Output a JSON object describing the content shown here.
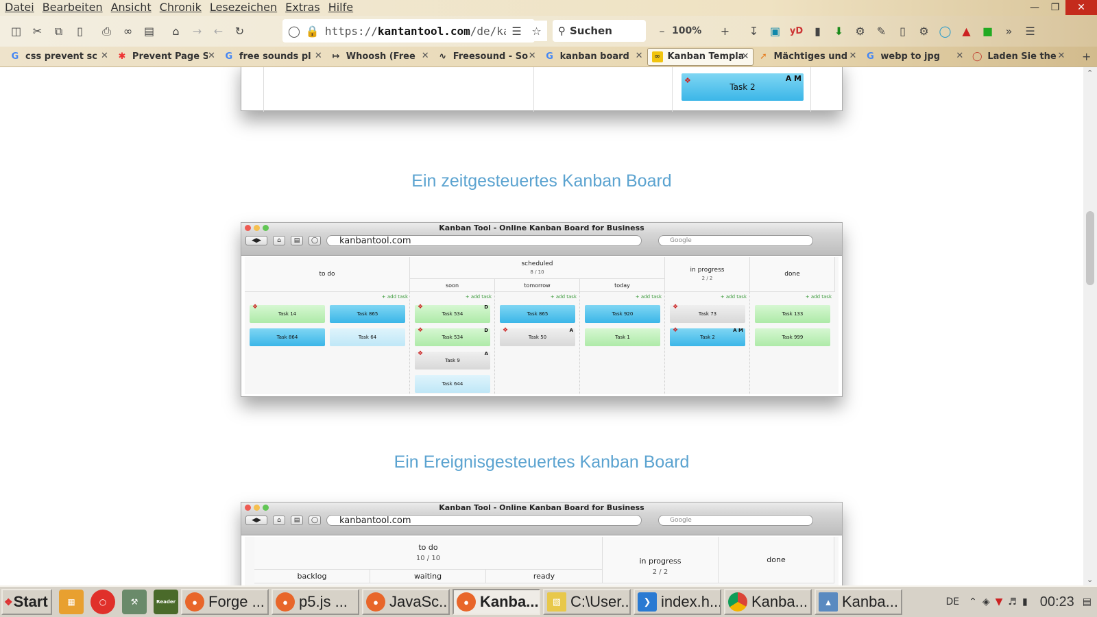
{
  "menubar": {
    "items": [
      "Datei",
      "Bearbeiten",
      "Ansicht",
      "Chronik",
      "Lesezeichen",
      "Extras",
      "Hilfe"
    ]
  },
  "navbar": {
    "url_prefix": "https://",
    "url_domain": "kantantool.com",
    "url_path": "/de/kan",
    "search_label": "Suchen",
    "zoom": "100%"
  },
  "tabs": [
    {
      "title": "css prevent sc",
      "icon": "google-icon"
    },
    {
      "title": "Prevent Page S",
      "icon": "asterisk-icon"
    },
    {
      "title": "free sounds pl",
      "icon": "google-icon"
    },
    {
      "title": "Whoosh (Free",
      "icon": "whoosh-icon"
    },
    {
      "title": "Freesound - So",
      "icon": "waveform-icon"
    },
    {
      "title": "kanban board",
      "icon": "google-icon"
    },
    {
      "title": "Kanban Templa",
      "icon": "kanban-icon",
      "active": true
    },
    {
      "title": "Mächtiges und",
      "icon": "chart-icon"
    },
    {
      "title": "webp to jpg",
      "icon": "google-icon"
    },
    {
      "title": "Laden Sie the",
      "icon": "opera-icon"
    }
  ],
  "content": {
    "heading1": "Ein zeitgesteuertes Kanban Board",
    "heading2": "Ein Ereignisgesteuertes Kanban Board",
    "top_card": {
      "label": "Task 2",
      "initials": "A M"
    },
    "mac": {
      "title": "Kanban Tool - Online Kanban Board for Business",
      "url": "kanbantool.com",
      "search_placeholder": "Google"
    },
    "board1": {
      "add_task": "+ add task",
      "col_todo": "to do",
      "col_scheduled": "scheduled",
      "scheduled_count": "8 / 10",
      "sub_soon": "soon",
      "sub_tomorrow": "tomorrow",
      "sub_today": "today",
      "col_inprogress": "in progress",
      "inprogress_count": "2 / 2",
      "col_done": "done",
      "cards": [
        {
          "label": "Task 14"
        },
        {
          "label": "Task 865"
        },
        {
          "label": "Task 864"
        },
        {
          "label": "Task 64"
        },
        {
          "label": "Task 534",
          "initials": "D"
        },
        {
          "label": "Task 534",
          "initials": "D"
        },
        {
          "label": "Task 9",
          "initials": "A"
        },
        {
          "label": "Task 644"
        },
        {
          "label": "Task 865"
        },
        {
          "label": "Task 50",
          "initials": "A"
        },
        {
          "label": "Task 920"
        },
        {
          "label": "Task 1"
        },
        {
          "label": "Task 73"
        },
        {
          "label": "Task 2",
          "initials": "A M"
        },
        {
          "label": "Task 133"
        },
        {
          "label": "Task 999"
        }
      ]
    },
    "board2": {
      "col_todo": "to do",
      "todo_count": "10 / 10",
      "sub_backlog": "backlog",
      "sub_waiting": "waiting",
      "sub_ready": "ready",
      "col_inprogress": "in progress",
      "inprogress_count": "2 / 2",
      "col_done": "done"
    }
  },
  "taskbar": {
    "start": "Start",
    "tasks": [
      {
        "label": "Forge ...",
        "icon": "firefox-icon"
      },
      {
        "label": "p5.js ...",
        "icon": "firefox-icon"
      },
      {
        "label": "JavaSc...",
        "icon": "firefox-icon"
      },
      {
        "label": "Kanba...",
        "icon": "firefox-icon",
        "active": true
      },
      {
        "label": "C:\\User...",
        "icon": "folder-icon"
      },
      {
        "label": "index.h...",
        "icon": "vscode-icon"
      },
      {
        "label": "Kanba...",
        "icon": "chrome-icon"
      },
      {
        "label": "Kanba...",
        "icon": "image-viewer-icon"
      }
    ],
    "lang": "DE",
    "clock": "00:23"
  },
  "colors": {
    "heading": "#5ba3d0",
    "card_blue": "#3bb6e8",
    "card_green": "#aeeaa8",
    "accent_add": "#3a9a3a"
  }
}
